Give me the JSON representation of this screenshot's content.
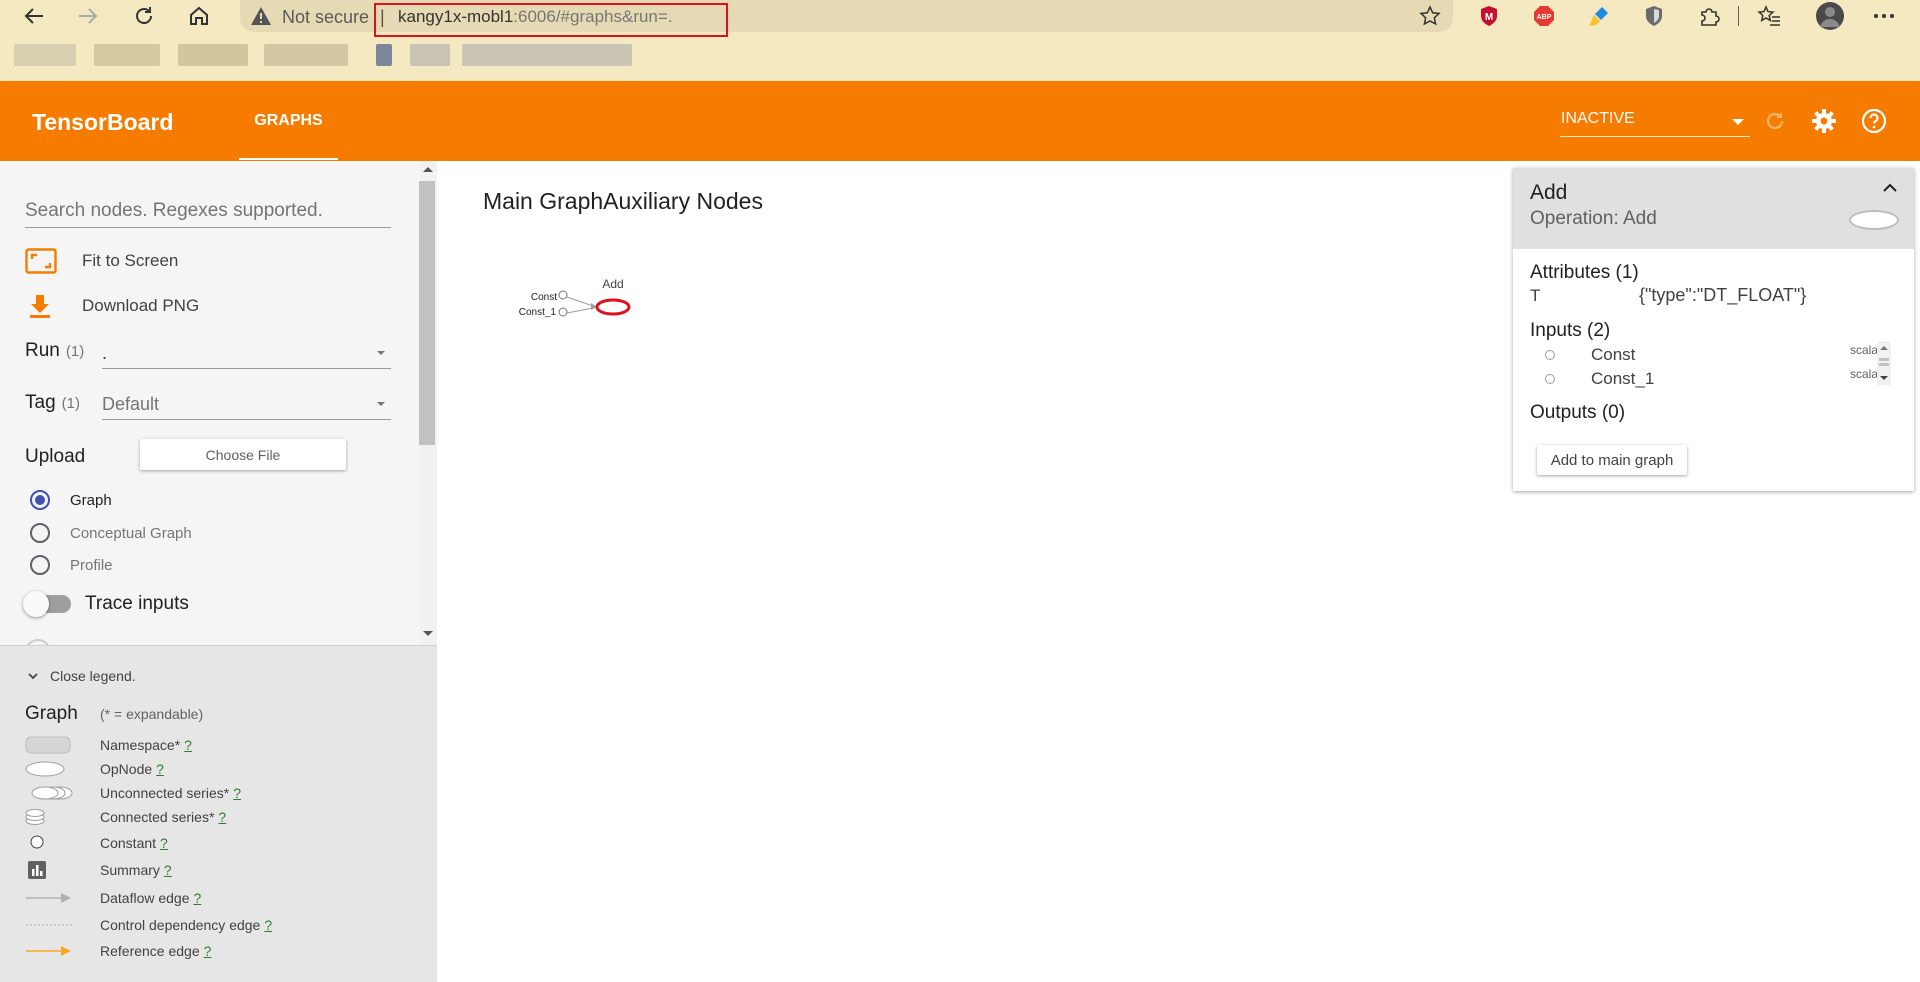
{
  "browser": {
    "not_secure": "Not secure",
    "url_host": "kangy1x-mobl1",
    "url_rest": ":6006/#graphs&run=.",
    "colors": {
      "chrome_bg": "#f4e9c0",
      "omnibox_bg": "#e5dab4",
      "highlight_box": "#e0101c"
    }
  },
  "header": {
    "brand": "TensorBoard",
    "tabs": [
      {
        "label": "GRAPHS",
        "active": true
      }
    ],
    "run_status": "INACTIVE",
    "colors": {
      "bar": "#f57c00",
      "text": "#ffffff"
    }
  },
  "sidebar": {
    "search_placeholder": "Search nodes. Regexes supported.",
    "fit_to_screen": "Fit to Screen",
    "download_png": "Download PNG",
    "run": {
      "label": "Run",
      "count": "(1)",
      "value": "."
    },
    "tag": {
      "label": "Tag",
      "count": "(1)",
      "value": "Default"
    },
    "upload": {
      "label": "Upload",
      "button": "Choose File"
    },
    "graph_types": [
      {
        "label": "Graph",
        "selected": true
      },
      {
        "label": "Conceptual Graph",
        "selected": false
      },
      {
        "label": "Profile",
        "selected": false
      }
    ],
    "trace_inputs": {
      "label": "Trace inputs",
      "on": false
    }
  },
  "legend": {
    "toggle": "Close legend.",
    "title": "Graph",
    "subtitle": "(* = expandable)",
    "items": [
      {
        "label": "Namespace*",
        "q": "?",
        "icon": "namespace-icon"
      },
      {
        "label": "OpNode",
        "q": "?",
        "icon": "opnode-icon"
      },
      {
        "label": "Unconnected series*",
        "q": "?",
        "icon": "unconnected-series-icon"
      },
      {
        "label": "Connected series*",
        "q": "?",
        "icon": "connected-series-icon"
      },
      {
        "label": "Constant",
        "q": "?",
        "icon": "constant-icon"
      },
      {
        "label": "Summary",
        "q": "?",
        "icon": "summary-icon"
      },
      {
        "label": "Dataflow edge",
        "q": "?",
        "icon": "dataflow-edge-icon"
      },
      {
        "label": "Control dependency edge",
        "q": "?",
        "icon": "control-edge-icon"
      },
      {
        "label": "Reference edge",
        "q": "?",
        "icon": "reference-edge-icon"
      }
    ]
  },
  "canvas": {
    "title": "Main GraphAuxiliary Nodes",
    "nodes": {
      "add": "Add",
      "const": "Const",
      "const_1": "Const_1"
    },
    "colors": {
      "selected_node": "#e0101c"
    }
  },
  "info_card": {
    "name": "Add",
    "operation": "Operation: Add",
    "attributes_title": "Attributes (1)",
    "attributes": [
      {
        "key": "T",
        "value": "{\"type\":\"DT_FLOAT\"}"
      }
    ],
    "inputs_title": "Inputs (2)",
    "inputs": [
      {
        "name": "Const",
        "type": "scalar"
      },
      {
        "name": "Const_1",
        "type": "scalar"
      }
    ],
    "outputs_title": "Outputs (0)",
    "add_button": "Add to main graph"
  }
}
